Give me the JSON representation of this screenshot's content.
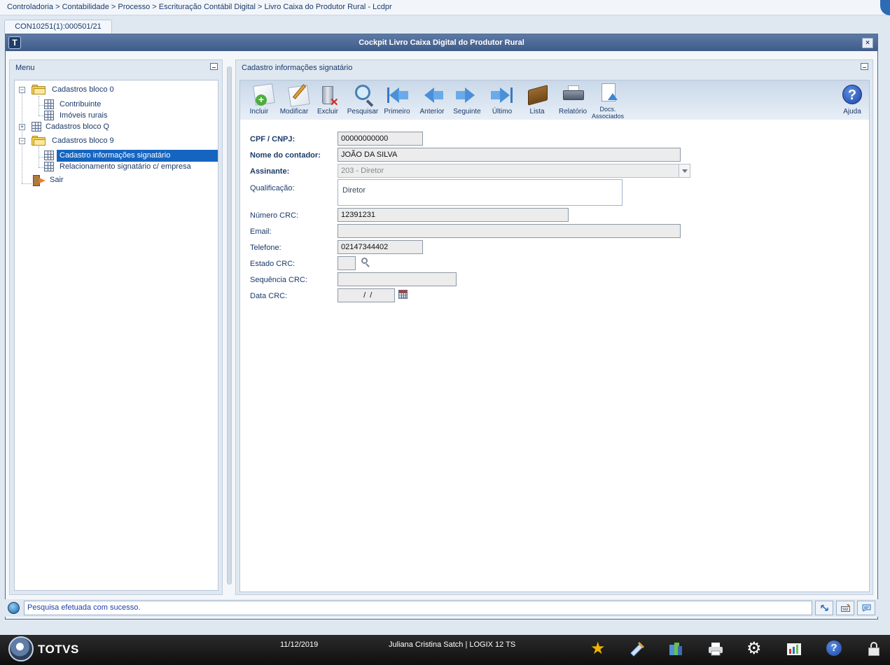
{
  "breadcrumb": "Controladoria > Contabilidade > Processo > Escrituração Contábil Digital > Livro Caixa do Produtor Rural - Lcdpr",
  "doc_tab": "CON10251(1):000501/21",
  "window": {
    "title": "Cockpit Livro Caixa Digital do Produtor Rural",
    "app_icon": "T",
    "close_glyph": "×"
  },
  "menu": {
    "header": "Menu",
    "items": [
      {
        "label": "Cadastros bloco 0",
        "icon": "folder-icon",
        "expander": "−"
      },
      {
        "label": "Contribuinte",
        "icon": "grid-icon"
      },
      {
        "label": "Imóveis rurais",
        "icon": "grid-icon"
      },
      {
        "label": "Cadastros bloco Q",
        "icon": "grid-icon",
        "expander": "+"
      },
      {
        "label": "Cadastros bloco 9",
        "icon": "folder-icon",
        "expander": "−"
      },
      {
        "label": "Cadastro informações signatário",
        "icon": "grid-icon",
        "selected": true
      },
      {
        "label": "Relacionamento signatário c/ empresa",
        "icon": "grid-icon"
      },
      {
        "label": "Sair",
        "icon": "exit-icon"
      }
    ]
  },
  "content": {
    "header": "Cadastro informações signatário",
    "toolbar": [
      {
        "label": "Incluir",
        "icon": "add-icon"
      },
      {
        "label": "Modificar",
        "icon": "edit-icon"
      },
      {
        "label": "Excluir",
        "icon": "delete-icon"
      },
      {
        "label": "Pesquisar",
        "icon": "search-icon"
      },
      {
        "label": "Primeiro",
        "icon": "first-icon"
      },
      {
        "label": "Anterior",
        "icon": "previous-icon"
      },
      {
        "label": "Seguinte",
        "icon": "next-icon"
      },
      {
        "label": "Último",
        "icon": "last-icon"
      },
      {
        "label": "Lista",
        "icon": "list-icon"
      },
      {
        "label": "Relatório",
        "icon": "print-icon"
      },
      {
        "label": "Docs. Associados",
        "label_line1": "Docs.",
        "label_line2": "Associados",
        "icon": "attached-docs-icon"
      },
      {
        "label": "Ajuda",
        "icon": "help-icon",
        "glyph": "?"
      }
    ],
    "form": {
      "cpf_cnpj": {
        "label": "CPF / CNPJ:",
        "value": "00000000000"
      },
      "nome_contador": {
        "label": "Nome do contador:",
        "value": "JOÃO DA SILVA"
      },
      "assinante": {
        "label": "Assinante:",
        "value": "203 - Diretor"
      },
      "qualificacao": {
        "label": "Qualificação:",
        "value": "Diretor"
      },
      "numero_crc": {
        "label": "Número CRC:",
        "value": "12391231"
      },
      "email": {
        "label": "Email:",
        "value": ""
      },
      "telefone": {
        "label": "Telefone:",
        "value": "02147344402"
      },
      "estado_crc": {
        "label": "Estado CRC:",
        "value": ""
      },
      "sequencia_crc": {
        "label": "Sequência CRC:",
        "value": ""
      },
      "data_crc": {
        "label": "Data CRC:",
        "value": "  /  /"
      }
    }
  },
  "status": {
    "message": "Pesquisa efetuada com sucesso."
  },
  "taskbar": {
    "brand": "TOTVS",
    "date": "11/12/2019",
    "user_info": "Juliana Cristina Satch | LOGIX 12 TS",
    "icons": [
      "favorites-star-icon",
      "edit-tool-icon",
      "modules-icon",
      "printer-icon",
      "settings-gear-icon",
      "chart-icon",
      "help-icon",
      "lock-icon"
    ],
    "star_glyph": "★",
    "gear_glyph": "⚙",
    "help_glyph": "?"
  }
}
